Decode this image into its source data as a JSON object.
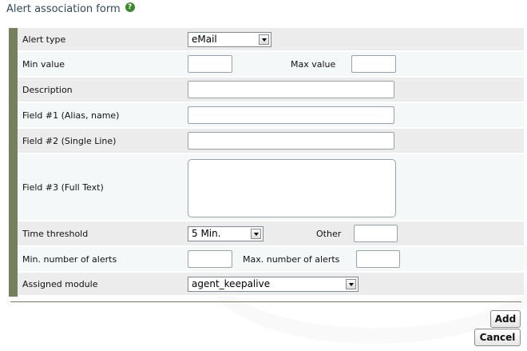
{
  "header": {
    "title": "Alert association form",
    "help_glyph": "?"
  },
  "form": {
    "alert_type": {
      "label": "Alert type",
      "value": "eMail"
    },
    "min_value": {
      "label": "Min value",
      "value": ""
    },
    "max_value": {
      "label": "Max value",
      "value": ""
    },
    "description": {
      "label": "Description",
      "value": ""
    },
    "field1": {
      "label": "Field #1 (Alias, name)",
      "value": ""
    },
    "field2": {
      "label": "Field #2 (Single Line)",
      "value": ""
    },
    "field3": {
      "label": "Field #3 (Full Text)",
      "value": ""
    },
    "time_threshold": {
      "label": "Time threshold",
      "value": "5 Min."
    },
    "other": {
      "label": "Other",
      "value": ""
    },
    "min_alerts": {
      "label": "Min. number of alerts",
      "value": ""
    },
    "max_alerts": {
      "label": "Max. number of alerts",
      "value": ""
    },
    "assigned_module": {
      "label": "Assigned module",
      "value": "agent_keepalive"
    }
  },
  "buttons": {
    "add": "Add",
    "cancel": "Cancel"
  },
  "colors": {
    "sidebar_accent": "#75815c",
    "title": "#2f4a5e",
    "help_icon": "#3c8a2e"
  }
}
